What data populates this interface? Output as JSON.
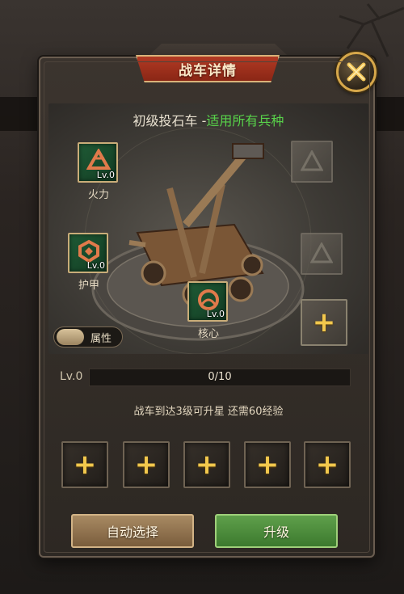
{
  "dialog": {
    "title": "战车详情",
    "vehicle_name": "初级投石车",
    "vehicle_sep": " -",
    "vehicle_tag": "适用所有兵种"
  },
  "slots": {
    "firepower": {
      "label": "火力",
      "level": "Lv.0"
    },
    "armor": {
      "label": "护甲",
      "level": "Lv.0"
    },
    "core": {
      "label": "核心",
      "level": "Lv.0"
    }
  },
  "toggle": {
    "label": "属性"
  },
  "progress": {
    "level": "Lv.0",
    "text": "0/10",
    "fraction": 0.0
  },
  "hint": "战车到达3级可升星  还需60经验",
  "materials": [
    "+",
    "+",
    "+",
    "+",
    "+"
  ],
  "add_slot_symbol": "+",
  "buttons": {
    "auto_select": "自动选择",
    "upgrade": "升级"
  },
  "colors": {
    "highlight_green": "#58d24a",
    "title_red": "#b23a24",
    "gold": "#d6a74a",
    "upgrade_green": "#5fa04b"
  }
}
